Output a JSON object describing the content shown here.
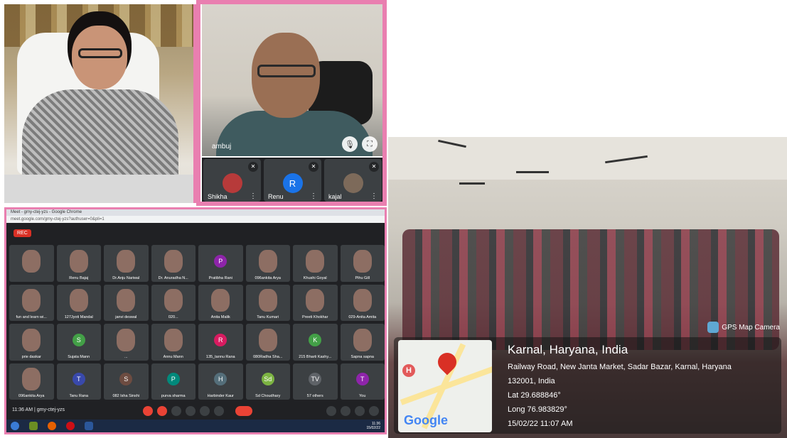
{
  "video_call": {
    "main_tile_name": "ambuj",
    "thumbnails": [
      {
        "name": "Shikha",
        "initial": "",
        "color": "#b73a3a"
      },
      {
        "name": "Renu",
        "initial": "R",
        "color": "#1a73e8"
      },
      {
        "name": "kajal",
        "initial": "",
        "color": "#7d6a5a"
      }
    ]
  },
  "meet_window": {
    "browser_title": "Meet - gmy-ctej-yzs - Google Chrome",
    "url": "meet.google.com/gmy-ctej-yzs?authuser=0&pli=1",
    "rec_label": "REC",
    "participants": [
      {
        "name": "",
        "type": "photo"
      },
      {
        "name": "Renu Bajaj",
        "type": "photo"
      },
      {
        "name": "Dr.Anju Nariwal",
        "type": "photo"
      },
      {
        "name": "Dr. Anuradha N...",
        "type": "photo"
      },
      {
        "name": "Pratibha Rani",
        "type": "avatar",
        "initial": "P",
        "color": "#8e24aa"
      },
      {
        "name": "096ankita Arya",
        "type": "photo"
      },
      {
        "name": "Khushi Goyal",
        "type": "photo"
      },
      {
        "name": "Pihu Gill",
        "type": "photo"
      },
      {
        "name": "fun and learn wi...",
        "type": "photo"
      },
      {
        "name": "127Jyoti Mandal",
        "type": "photo"
      },
      {
        "name": "janvi deswal",
        "type": "photo"
      },
      {
        "name": "020...",
        "type": "photo"
      },
      {
        "name": "Anita Malik",
        "type": "photo"
      },
      {
        "name": "Tanu Kumari",
        "type": "photo"
      },
      {
        "name": "Preeti Khokhar",
        "type": "photo"
      },
      {
        "name": "029-Anita Amita",
        "type": "photo"
      },
      {
        "name": "prie daskar",
        "type": "photo"
      },
      {
        "name": "Sujata Mann",
        "type": "avatar",
        "initial": "S",
        "color": "#43a047"
      },
      {
        "name": "...",
        "type": "photo"
      },
      {
        "name": "Annu Mann",
        "type": "photo"
      },
      {
        "name": "135_tannu Rana",
        "type": "avatar",
        "initial": "R",
        "color": "#d81b60"
      },
      {
        "name": "080Radha Sha...",
        "type": "photo"
      },
      {
        "name": "215 Bharti Kashy...",
        "type": "avatar",
        "initial": "K",
        "color": "#43a047"
      },
      {
        "name": "Sapna sapna",
        "type": "photo"
      },
      {
        "name": "096ankita Arya",
        "type": "photo"
      },
      {
        "name": "Tanu Rana",
        "type": "avatar",
        "initial": "T",
        "color": "#3949ab"
      },
      {
        "name": "082 Isha Sinshi",
        "type": "avatar",
        "initial": "S",
        "color": "#6d4c41"
      },
      {
        "name": "purva sharma",
        "type": "avatar",
        "initial": "P",
        "color": "#00897b"
      },
      {
        "name": "Harbinder Kaur",
        "type": "avatar",
        "initial": "H",
        "color": "#546e7a"
      },
      {
        "name": "Sd Choudhary",
        "type": "avatar",
        "initial": "Sd",
        "color": "#7cb342"
      },
      {
        "name": "57 others",
        "type": "avatar",
        "initial": "TV",
        "color": "#5f6368"
      },
      {
        "name": "You",
        "type": "avatar",
        "initial": "T",
        "color": "#8e24aa"
      }
    ],
    "time_and_code": "11:36 AM  |  gmy-ctej-yzs",
    "taskbar_clock": "11:36",
    "taskbar_date": "15/02/22"
  },
  "classroom_photo": {
    "gps_brand": "GPS Map Camera",
    "location_title": "Karnal, Haryana, India",
    "address_line1": "Railway Road, New Janta Market, Sadar Bazar, Karnal, Haryana",
    "address_line2": "132001, India",
    "latitude": "Lat 29.688846°",
    "longitude": "Long 76.983829°",
    "timestamp": "15/02/22 11:07 AM",
    "map_logo": "Google",
    "map_hospital_marker": "H"
  },
  "colors": {
    "frame_pink": "#e97fb0",
    "meet_bg": "#202124",
    "end_call_red": "#ea4335"
  }
}
